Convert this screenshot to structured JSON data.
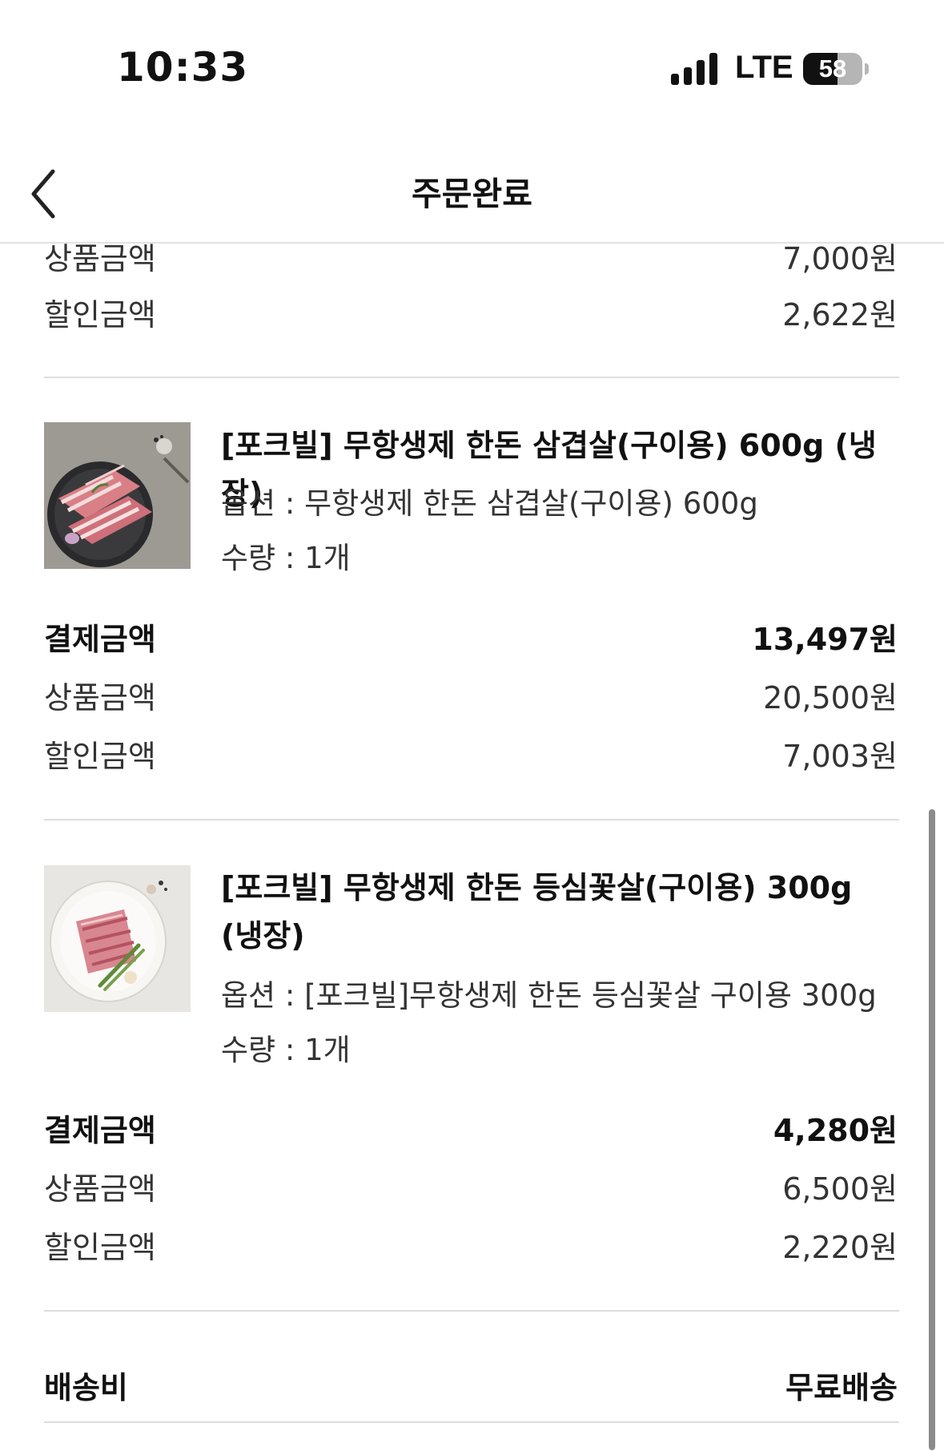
{
  "status_bar": {
    "time": "10:33",
    "network": "LTE",
    "battery": "58",
    "battery_level": 0.58
  },
  "header": {
    "title": "주문완료"
  },
  "top_summary": {
    "product_amount_label": "상품금액",
    "product_amount": "7,000원",
    "discount_label": "할인금액",
    "discount": "2,622원"
  },
  "items": [
    {
      "name": "[포크빌] 무항생제 한돈 삼겹살(구이용) 600g (냉장)",
      "option": "옵션 : 무항생제 한돈 삼겹살(구이용) 600g",
      "quantity": "수량 : 1개",
      "payment_label": "결제금액",
      "payment": "13,497원",
      "product_amount_label": "상품금액",
      "product_amount": "20,500원",
      "discount_label": "할인금액",
      "discount": "7,003원"
    },
    {
      "name": "[포크빌] 무항생제 한돈 등심꽃살(구이용) 300g (냉장)",
      "option": "옵션 : [포크빌]무항생제 한돈 등심꽃살 구이용 300g",
      "quantity": "수량 : 1개",
      "payment_label": "결제금액",
      "payment": "4,280원",
      "product_amount_label": "상품금액",
      "product_amount": "6,500원",
      "discount_label": "할인금액",
      "discount": "2,220원"
    }
  ],
  "shipping": {
    "label": "배송비",
    "value": "무료배송"
  },
  "icons": {
    "back": "chevron-left-icon",
    "signal": "cellular-signal-icon",
    "battery": "battery-icon"
  }
}
